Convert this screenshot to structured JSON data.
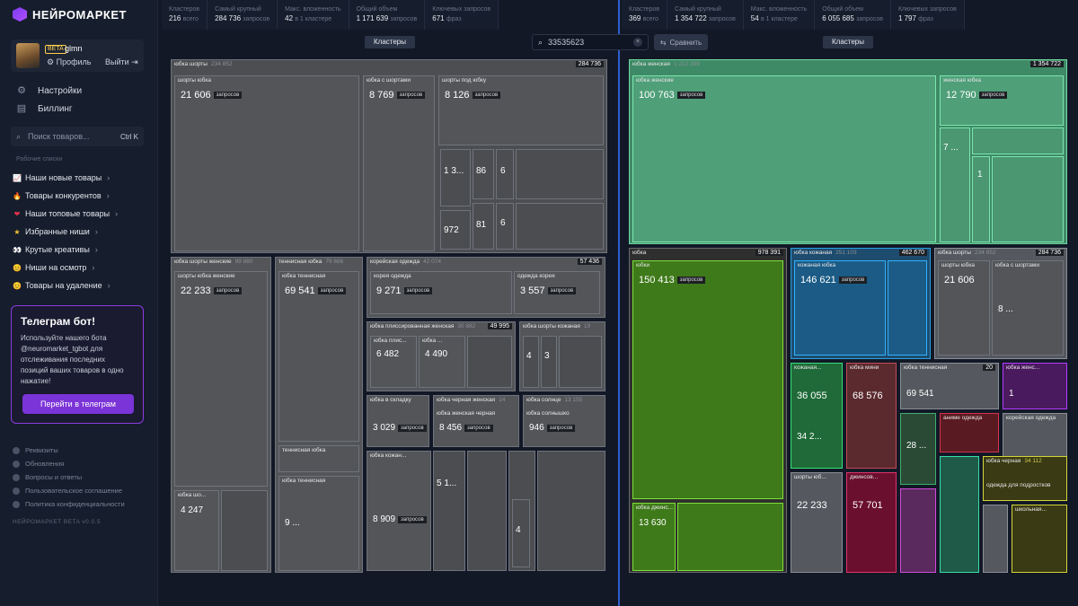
{
  "app": {
    "name": "НЕЙРОМАРКЕТ"
  },
  "user": {
    "beta": "BETA",
    "name": "glmn",
    "profile": "Профиль",
    "logout": "Выйти"
  },
  "nav": {
    "settings": "Настройки",
    "billing": "Биллинг"
  },
  "search": {
    "placeholder": "Поиск товаров...",
    "shortcut": "Ctrl K"
  },
  "lists": {
    "section": "Рабочие списки",
    "items": [
      {
        "emoji": "📈",
        "label": "Наши новые товары"
      },
      {
        "emoji": "🔥",
        "label": "Товары конкурентов"
      },
      {
        "emoji": "❤",
        "label": "Наши топовые товары"
      },
      {
        "emoji": "★",
        "label": "Избранные ниши"
      },
      {
        "emoji": "👀",
        "label": "Крутые креативы"
      },
      {
        "emoji": "😊",
        "label": "Ниши на осмотр"
      },
      {
        "emoji": "😊",
        "label": "Товары на удаление"
      }
    ]
  },
  "telegram": {
    "title": "Телеграм бот!",
    "text": "Используйте нашего бота @neuromarket_tgbot для отслеживания последних позиций ваших товаров в одно нажатие!",
    "button": "Перейти в телеграм"
  },
  "footer": [
    "Реквизиты",
    "Обновления",
    "Вопросы и ответы",
    "Пользовательское соглашение",
    "Политика конфиденциальности"
  ],
  "version": "НЕЙРОМАРКЕТ BETA v0.0.5",
  "stats_left": [
    {
      "label": "Кластеров",
      "value": "216",
      "sub": "всего"
    },
    {
      "label": "Самый крупный",
      "value": "284 736",
      "sub": "запросов"
    },
    {
      "label": "Макс. вложенность",
      "value": "42",
      "sub": "в 1 кластере"
    },
    {
      "label": "Общий объем",
      "value": "1 171 639",
      "sub": "запросов"
    },
    {
      "label": "Ключевых запросов",
      "value": "671",
      "sub": "фраз"
    }
  ],
  "stats_right": [
    {
      "label": "Кластеров",
      "value": "369",
      "sub": "всего"
    },
    {
      "label": "Самый крупный",
      "value": "1 354 722",
      "sub": "запросов"
    },
    {
      "label": "Макс. вложенность",
      "value": "54",
      "sub": "в 1 кластере"
    },
    {
      "label": "Общий объем",
      "value": "6 055 685",
      "sub": "запросов"
    },
    {
      "label": "Ключевых запросов",
      "value": "1 797",
      "sub": "фраз"
    }
  ],
  "toolbar": {
    "clusters_left": "Кластеры",
    "clusters_right": "Кластеры",
    "query": "33535623",
    "compare": "Сравнить"
  },
  "unit": "запросов",
  "left_map": {
    "boxes": [
      {
        "t": "юбка шорты",
        "g": "234 852",
        "c": "284 736"
      },
      {
        "t": "шорты юбка",
        "n": "21 606"
      },
      {
        "t": "юбка с шортами",
        "n": "8 769"
      },
      {
        "t": "шорты под юбку",
        "n": "8 126"
      },
      {
        "t": "юбка шорты женские",
        "g": "99 880"
      },
      {
        "t": "шорты юбка женские",
        "n": "22 233"
      },
      {
        "t": "теннисная юбка",
        "g": "79 686"
      },
      {
        "t": "юбка теннисная",
        "n": "69 541"
      },
      {
        "t": "корейская одежда",
        "g": "42 074",
        "c": "57 436"
      },
      {
        "t": "корея одежда",
        "n": "9 271"
      },
      {
        "t": "одежда корея",
        "n": "3 557"
      },
      {
        "t": "юбка плиссированная женская",
        "g": "30 882",
        "c": "49 995"
      },
      {
        "t": "юбка плис...",
        "n": "6 482"
      },
      {
        "t": "юбка ...",
        "n": "4 490"
      },
      {
        "t": "юбка шорты кожаная",
        "g": "19"
      },
      {
        "t": "юбка в складку",
        "n": "3 029"
      },
      {
        "t": "юбка черная женская",
        "g": "14"
      },
      {
        "t": "юбка женская черная",
        "n": "8 456"
      },
      {
        "t": "юбка солнце",
        "g": "13 155"
      },
      {
        "t": "юбка солнышко",
        "n": "946"
      },
      {
        "t": "юбка кожан...",
        "n": "8 909"
      },
      {
        "t": "юбка шо...",
        "n": "4 247"
      },
      {
        "t": "теннисная юбка"
      },
      {
        "t": "юбка теннисная",
        "n": "9 ..."
      }
    ],
    "small_values": [
      "1 3...",
      "86",
      "6",
      "972",
      "81",
      "6",
      "4",
      "3",
      "5 1...",
      "4"
    ]
  },
  "right_map": {
    "boxes": [
      {
        "t": "юбка женская",
        "g": "1 212 399",
        "c": "1 354 722"
      },
      {
        "t": "юбка женские",
        "n": "100 763"
      },
      {
        "t": "женская юбка",
        "n": "12 790"
      },
      {
        "t": "юбка",
        "c": "978 391"
      },
      {
        "t": "юбки",
        "n": "150 413"
      },
      {
        "t": "юбка кожаная",
        "g": "251 103",
        "c": "462 670"
      },
      {
        "t": "кожаная юбка",
        "n": "146 621"
      },
      {
        "t": "юбка шорты",
        "g": "234 852",
        "c": "284 736"
      },
      {
        "t": "шорты юбка",
        "n": "21 606"
      },
      {
        "t": "юбка с шортами"
      },
      {
        "t": "юбка мини",
        "n": "68 576"
      },
      {
        "t": "кожаная...",
        "n": "36 055"
      },
      {
        "t": "юбка теннисная",
        "n": "69 541"
      },
      {
        "t": "шорты юб...",
        "n": "22 233"
      },
      {
        "t": "джинсов...",
        "n": "57 701"
      },
      {
        "t": "юбка джинс...",
        "n": "13 630"
      },
      {
        "t": "юбка черная",
        "g": "34 112"
      },
      {
        "t": "одежда для подростков"
      },
      {
        "t": "корейская одежда"
      },
      {
        "t": "аниме одежда"
      },
      {
        "t": "юбка женс..."
      },
      {
        "t": "школьная..."
      }
    ],
    "small_values": [
      "7 ...",
      "1",
      "1",
      "34 2...",
      "28 ...",
      "1",
      "8 ...",
      "20"
    ]
  }
}
